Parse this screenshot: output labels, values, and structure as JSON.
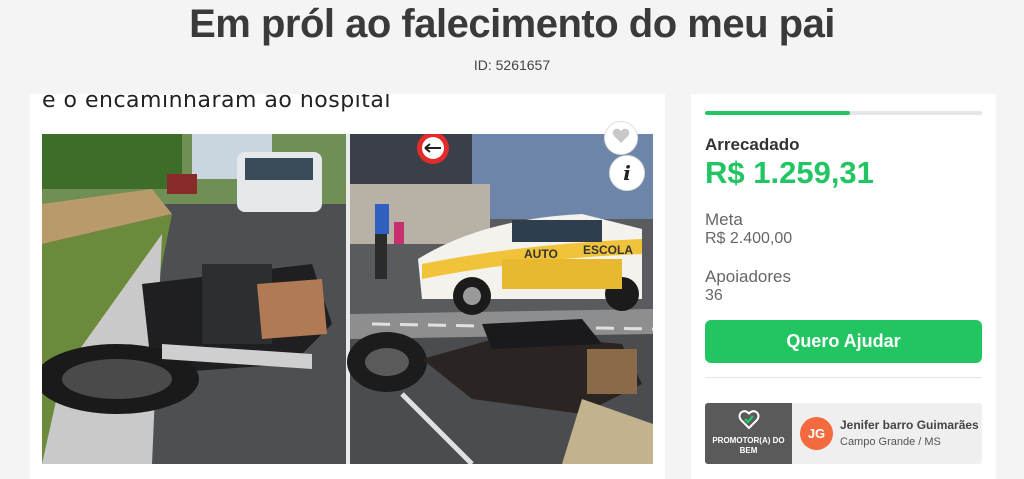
{
  "page": {
    "title": "Em pról ao falecimento do meu pai",
    "id_text": "ID: 5261657"
  },
  "media": {
    "caption": "e o encaminharam ao hospital",
    "favorite_icon": "heart-icon",
    "info_icon": "info-icon",
    "info_glyph": "i",
    "photo_text": {
      "sign_1": "AUTO",
      "sign_2": "ESCOLA"
    }
  },
  "summary": {
    "raised_label": "Arrecadado",
    "raised_value": "R$ 1.259,31",
    "goal_label": "Meta",
    "goal_value": "R$ 2.400,00",
    "supporters_label": "Apoiadores",
    "supporters_value": "36",
    "progress_fraction": 0.5247,
    "help_button_label": "Quero Ajudar",
    "accent_color": "#23c562"
  },
  "promoter": {
    "badge_text": "PROMOTOR(A) DO BEM",
    "badge_icon": "heart-check-icon",
    "initials": "JG",
    "name": "Jenifer barro Guimarães",
    "location": "Campo Grande / MS",
    "avatar_color": "#f26a3d"
  }
}
